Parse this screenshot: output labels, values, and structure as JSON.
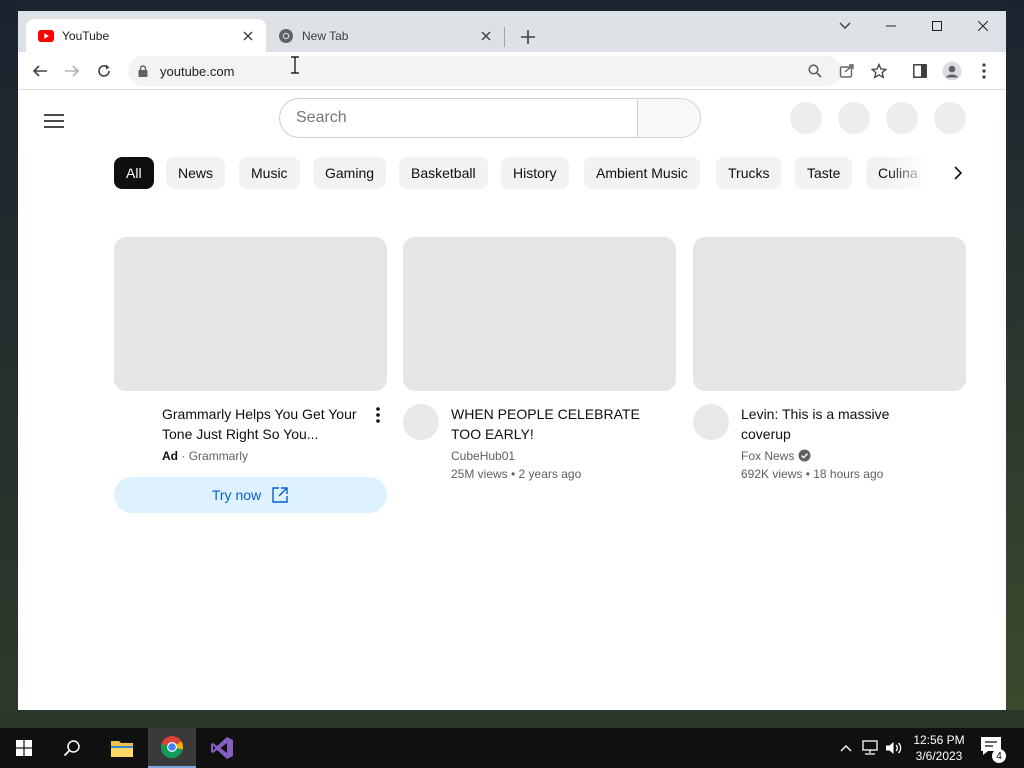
{
  "browser": {
    "tabs": [
      {
        "label": "YouTube",
        "active": true,
        "icon": "youtube-icon"
      },
      {
        "label": "New Tab",
        "active": false,
        "icon": "chrome-icon"
      }
    ],
    "url": "youtube.com"
  },
  "youtube": {
    "search": {
      "placeholder": "Search"
    },
    "chips": [
      {
        "label": "All",
        "selected": true
      },
      {
        "label": "News"
      },
      {
        "label": "Music"
      },
      {
        "label": "Gaming"
      },
      {
        "label": "Basketball"
      },
      {
        "label": "History"
      },
      {
        "label": "Ambient Music"
      },
      {
        "label": "Trucks"
      },
      {
        "label": "Taste"
      },
      {
        "label": "Culina"
      }
    ],
    "videos": [
      {
        "title": "Grammarly Helps You Get Your Tone Just Right So You...",
        "ad_label": "Ad",
        "separator": "·",
        "advertiser": "Grammarly",
        "cta": "Try now"
      },
      {
        "title": "WHEN PEOPLE CELEBRATE TOO EARLY!",
        "channel": "CubeHub01",
        "stats": "25M views • 2 years ago"
      },
      {
        "title": "Levin: This is a massive coverup",
        "channel": "Fox News",
        "verified": true,
        "stats": "692K views • 18 hours ago"
      }
    ]
  },
  "taskbar": {
    "time": "12:56 PM",
    "date": "3/6/2023",
    "notification_count": "4"
  },
  "colors": {
    "chip_selected": "#0f0f0f",
    "cta_bg": "#def1ff",
    "cta_text": "#065fd4",
    "youtube_red": "#ff0000"
  }
}
